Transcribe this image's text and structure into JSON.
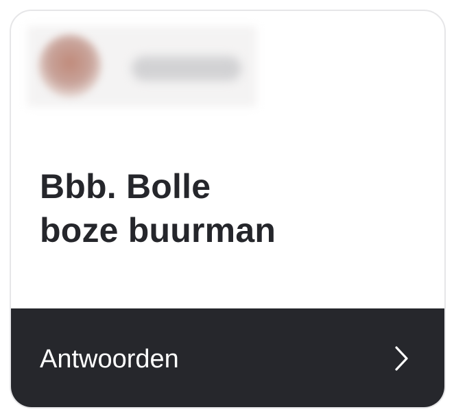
{
  "post": {
    "title_line1": "Bbb. Bolle",
    "title_line2": "boze buurman"
  },
  "action": {
    "label": "Antwoorden",
    "icon": "chevron-right-icon"
  },
  "colors": {
    "footer_bg": "#26272c",
    "title_text": "#25262b",
    "card_border": "#e6e6e8"
  }
}
